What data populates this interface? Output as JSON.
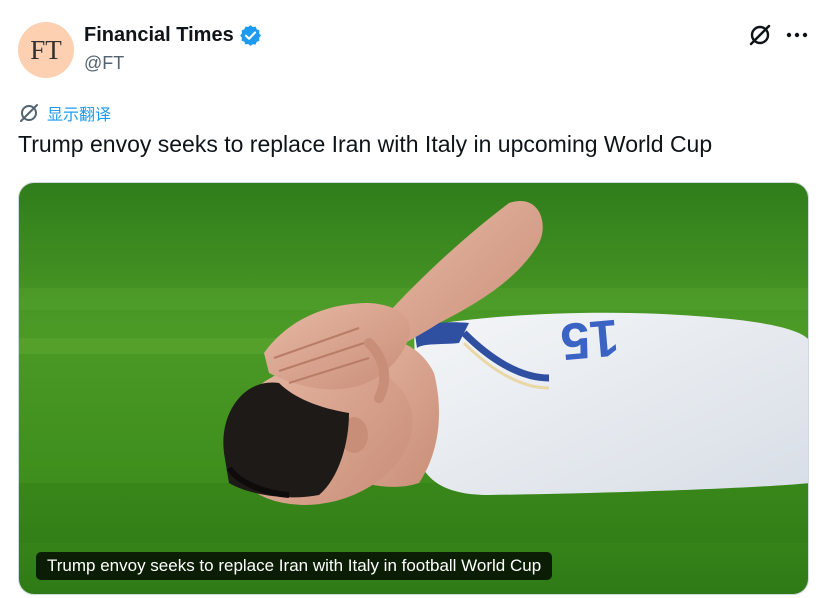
{
  "author": {
    "avatar_text": "FT",
    "display_name": "Financial Times",
    "handle": "@FT",
    "verified": true,
    "avatar_color": "#fcd0b1"
  },
  "header_actions": {
    "grok_icon": "grok-slash-circle-icon",
    "more_icon": "more-horizontal-icon"
  },
  "translate": {
    "icon": "translate-slash-circle-icon",
    "label": "显示翻译"
  },
  "tweet": {
    "text": "Trump envoy seeks to replace Iran with Italy in upcoming World Cup"
  },
  "media": {
    "caption": "Trump envoy seeks to replace Iran with Italy in football World Cup",
    "jersey_number": "15"
  },
  "colors": {
    "accent": "#1d9bf0",
    "secondary_text": "#536471",
    "pitch_green": "#3f8f1e"
  }
}
